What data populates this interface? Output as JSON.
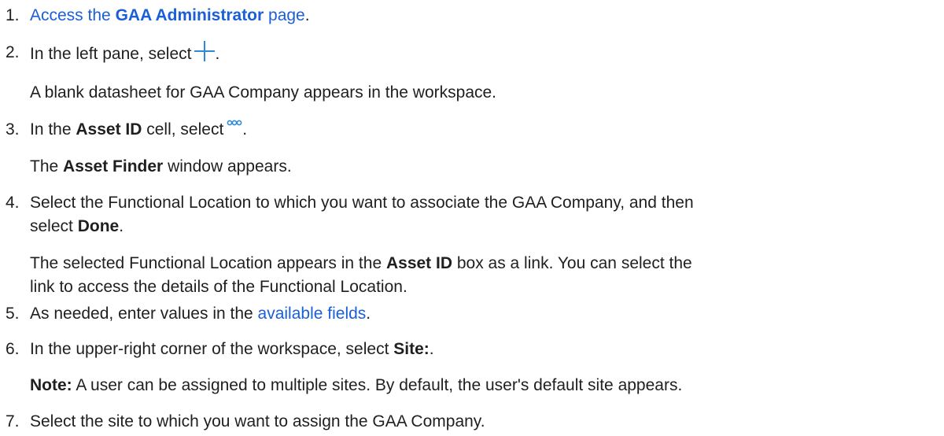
{
  "steps": [
    {
      "number": "1.",
      "link_pre": "Access the ",
      "link_bold": "GAA Administrator",
      "link_post": " page",
      "tail": "."
    },
    {
      "number": "2.",
      "text": "In the left pane, select",
      "icon": "plus-icon",
      "tail": ".",
      "result": "A blank datasheet for GAA Company appears in the workspace."
    },
    {
      "number": "3.",
      "pre": "In the ",
      "bold": "Asset ID",
      "post": " cell, select",
      "icon": "more-options-icon",
      "tail": ".",
      "result_pre": "The ",
      "result_bold": "Asset Finder",
      "result_post": " window appears."
    },
    {
      "number": "4.",
      "line1": "Select the Functional Location to which you want to associate the GAA Company, and then",
      "line2_pre": "select ",
      "line2_bold": "Done",
      "line2_post": ".",
      "result_line1_pre": "The selected Functional Location appears in the ",
      "result_line1_bold": "Asset ID",
      "result_line1_post": " box as a link. You can select the",
      "result_line2": "link to access the details of the Functional Location."
    },
    {
      "number": "5.",
      "pre": "As needed, enter values in the ",
      "link": "available fields",
      "tail": "."
    },
    {
      "number": "6.",
      "pre": "In the upper-right corner of the workspace, select ",
      "bold": "Site:",
      "tail": ".",
      "note_label": "Note:",
      "note_text": " A user can be assigned to multiple sites. By default, the user's default site appears."
    },
    {
      "number": "7.",
      "text": "Select the site to which you want to assign the GAA Company."
    }
  ],
  "colors": {
    "link": "#1a5fd6",
    "icon_blue": "#2f8ad6",
    "text": "#1f1f1f"
  }
}
